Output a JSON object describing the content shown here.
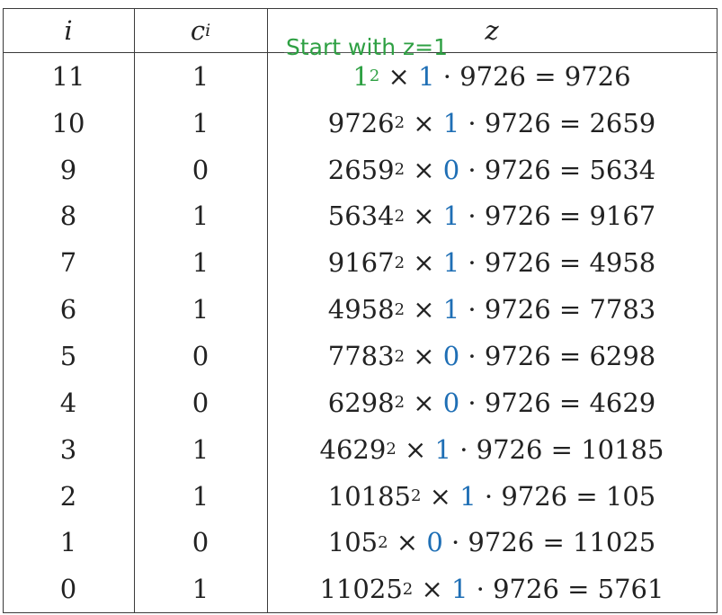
{
  "table": {
    "headers": {
      "i": "i",
      "c": "c",
      "c_sub": "i",
      "z": "z"
    },
    "annotation": "Start with z=1",
    "multiplier": "9726",
    "rows": [
      {
        "i": "11",
        "c": "1",
        "base": "1",
        "exp": "2",
        "bit": "1",
        "result": "9726",
        "base_green": true
      },
      {
        "i": "10",
        "c": "1",
        "base": "9726",
        "exp": "2",
        "bit": "1",
        "result": "2659"
      },
      {
        "i": "9",
        "c": "0",
        "base": "2659",
        "exp": "2",
        "bit": "0",
        "result": "5634"
      },
      {
        "i": "8",
        "c": "1",
        "base": "5634",
        "exp": "2",
        "bit": "1",
        "result": "9167"
      },
      {
        "i": "7",
        "c": "1",
        "base": "9167",
        "exp": "2",
        "bit": "1",
        "result": "4958"
      },
      {
        "i": "6",
        "c": "1",
        "base": "4958",
        "exp": "2",
        "bit": "1",
        "result": "7783"
      },
      {
        "i": "5",
        "c": "0",
        "base": "7783",
        "exp": "2",
        "bit": "0",
        "result": "6298"
      },
      {
        "i": "4",
        "c": "0",
        "base": "6298",
        "exp": "2",
        "bit": "0",
        "result": "4629"
      },
      {
        "i": "3",
        "c": "1",
        "base": "4629",
        "exp": "2",
        "bit": "1",
        "result": "10185"
      },
      {
        "i": "2",
        "c": "1",
        "base": "10185",
        "exp": "2",
        "bit": "1",
        "result": "105"
      },
      {
        "i": "1",
        "c": "0",
        "base": "105",
        "exp": "2",
        "bit": "0",
        "result": "11025"
      },
      {
        "i": "0",
        "c": "1",
        "base": "11025",
        "exp": "2",
        "bit": "1",
        "result": "5761"
      }
    ]
  },
  "colors": {
    "bit": "#1f6fb5",
    "annotation": "#2ea043",
    "border": "#3a3a3a"
  }
}
